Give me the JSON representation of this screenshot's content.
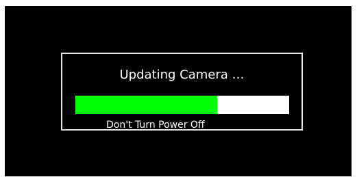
{
  "dialog": {
    "title": "Updating Camera …",
    "warning": "Don't Turn Power Off"
  },
  "progress": {
    "fraction": 0.665
  },
  "colors": {
    "background": "#000000",
    "progress_fill": "#00ff00",
    "progress_track": "#ffffff",
    "border": "#e6e6e6",
    "text": "#ffffff"
  }
}
